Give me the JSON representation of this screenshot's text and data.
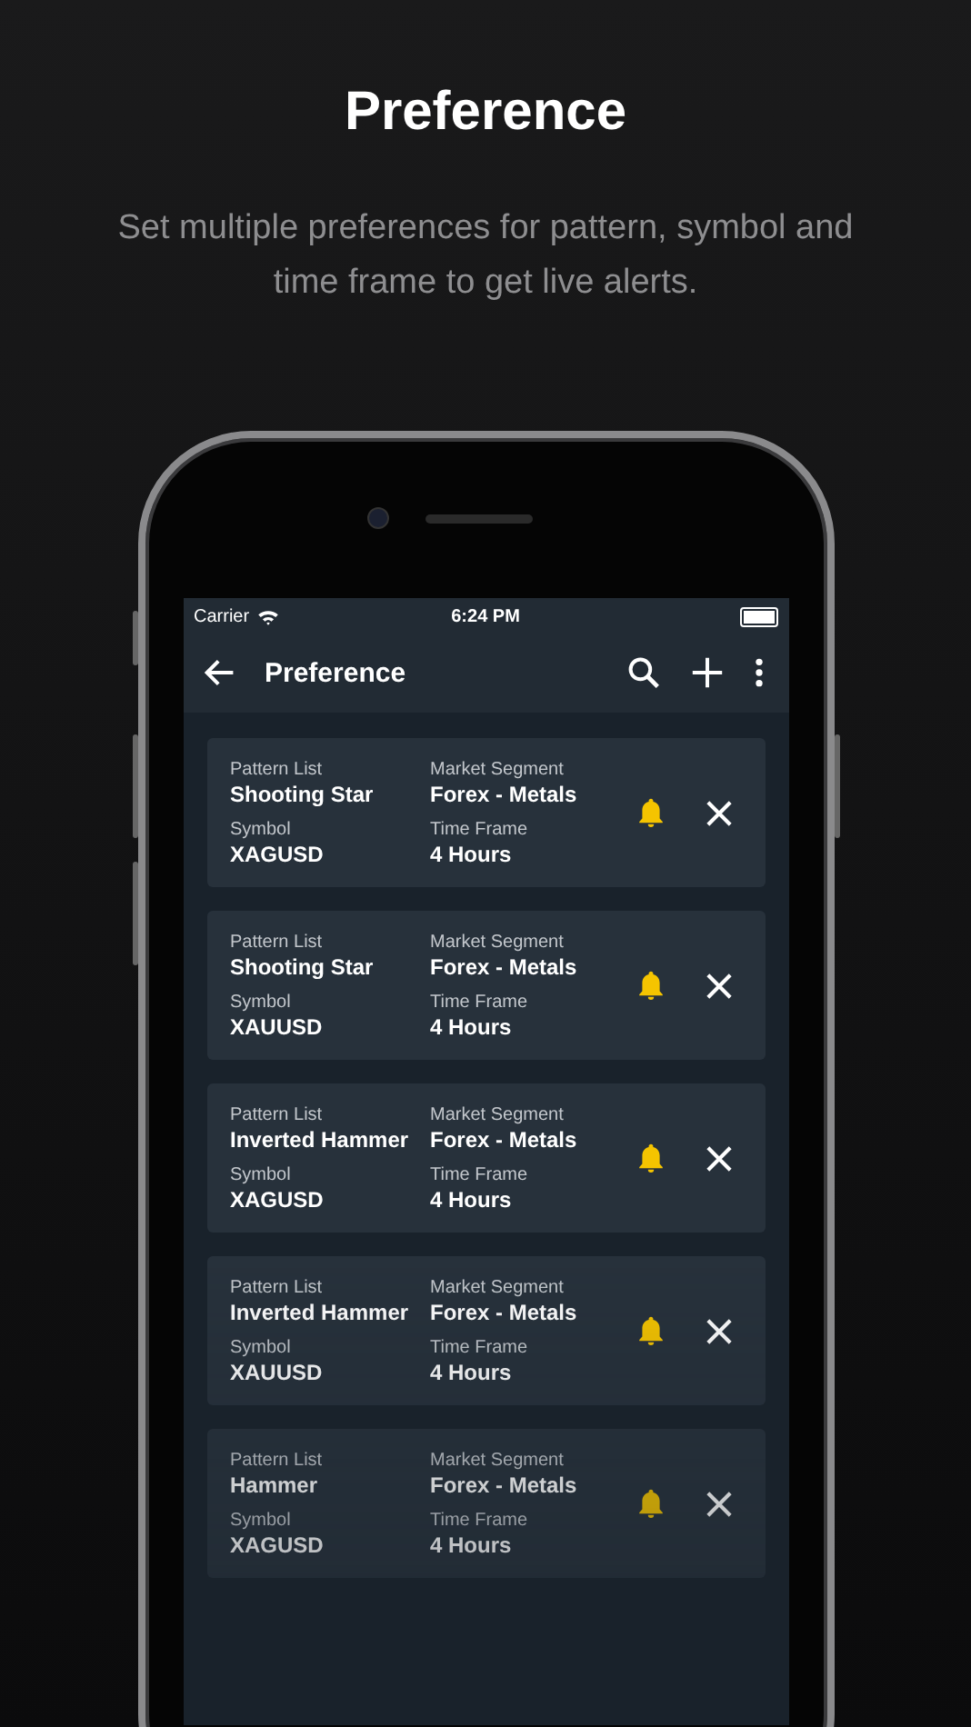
{
  "heading": "Preference",
  "subtitle": "Set multiple preferences for pattern, symbol and time frame to get live alerts.",
  "status_bar": {
    "carrier": "Carrier",
    "time": "6:24 PM"
  },
  "app_bar": {
    "title": "Preference"
  },
  "preferences": [
    {
      "fields": [
        {
          "label": "Pattern List",
          "value": "Shooting Star"
        },
        {
          "label": "Market Segment",
          "value": "Forex - Metals"
        },
        {
          "label": "Symbol",
          "value": "XAGUSD"
        },
        {
          "label": "Time Frame",
          "value": "4 Hours"
        }
      ]
    },
    {
      "fields": [
        {
          "label": "Pattern List",
          "value": "Shooting Star"
        },
        {
          "label": "Market Segment",
          "value": "Forex - Metals"
        },
        {
          "label": "Symbol",
          "value": "XAUUSD"
        },
        {
          "label": "Time Frame",
          "value": "4 Hours"
        }
      ]
    },
    {
      "fields": [
        {
          "label": "Pattern List",
          "value": "Inverted Hammer"
        },
        {
          "label": "Market Segment",
          "value": "Forex - Metals"
        },
        {
          "label": "Symbol",
          "value": "XAGUSD"
        },
        {
          "label": "Time Frame",
          "value": "4 Hours"
        }
      ]
    },
    {
      "fields": [
        {
          "label": "Pattern List",
          "value": "Inverted Hammer"
        },
        {
          "label": "Market Segment",
          "value": "Forex - Metals"
        },
        {
          "label": "Symbol",
          "value": "XAUUSD"
        },
        {
          "label": "Time Frame",
          "value": "4 Hours"
        }
      ]
    },
    {
      "fields": [
        {
          "label": "Pattern List",
          "value": "Hammer"
        },
        {
          "label": "Market Segment",
          "value": "Forex - Metals"
        },
        {
          "label": "Symbol",
          "value": "XAGUSD"
        },
        {
          "label": "Time Frame",
          "value": "4 Hours"
        }
      ]
    }
  ]
}
